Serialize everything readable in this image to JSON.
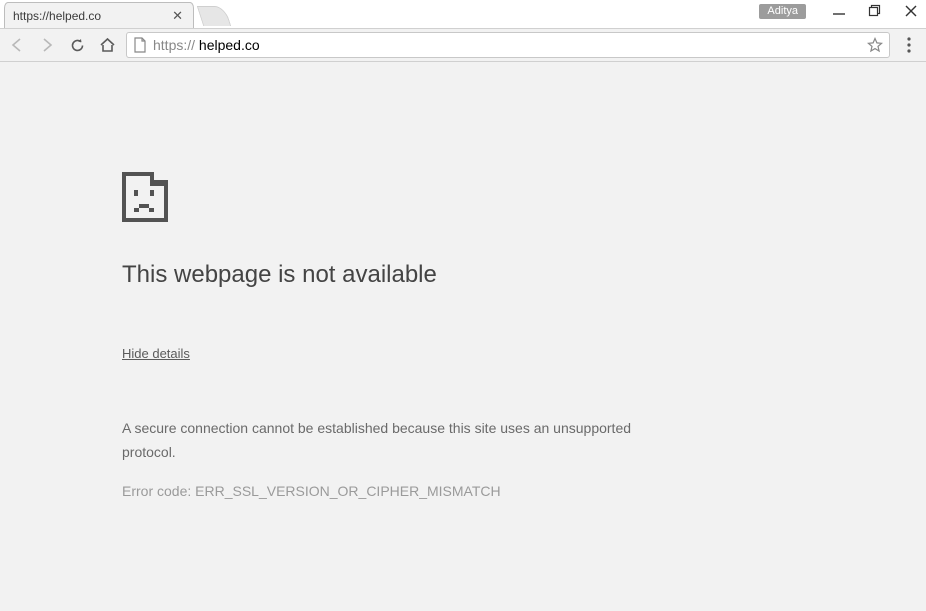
{
  "window": {
    "profile_name": "Aditya"
  },
  "tab": {
    "title": "https://helped.co"
  },
  "omnibox": {
    "scheme": "https://",
    "host": " helped.co"
  },
  "error": {
    "title": "This webpage is not available",
    "details_toggle": "Hide details",
    "description": "A secure connection cannot be established because this site uses an unsupported protocol.",
    "code_label": "Error code: ",
    "code": "ERR_SSL_VERSION_OR_CIPHER_MISMATCH"
  }
}
